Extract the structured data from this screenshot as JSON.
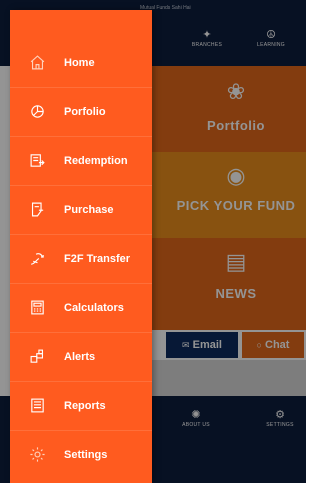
{
  "app": {
    "title": "Mutual Funds Sahi Hai",
    "top_nav": [
      {
        "label": "BRANCHES",
        "icon": "branches-icon"
      },
      {
        "label": "LEARNING",
        "icon": "learning-icon"
      }
    ],
    "tiles": {
      "portfolio": "Portfolio",
      "pick_fund": "PICK YOUR FUND",
      "news": "NEWS"
    },
    "contact": {
      "email": "Email",
      "chat": "Chat"
    },
    "bottom_nav": [
      {
        "label": "ABOUT US",
        "icon": "about-icon"
      },
      {
        "label": "SETTINGS",
        "icon": "settings-icon"
      }
    ]
  },
  "drawer": {
    "items": [
      {
        "label": "Home",
        "icon": "home-icon"
      },
      {
        "label": "Porfolio",
        "icon": "portfolio-icon"
      },
      {
        "label": "Redemption",
        "icon": "redemption-icon"
      },
      {
        "label": "Purchase",
        "icon": "purchase-icon"
      },
      {
        "label": "F2F Transfer",
        "icon": "f2f-transfer-icon"
      },
      {
        "label": "Calculators",
        "icon": "calculator-icon"
      },
      {
        "label": "Alerts",
        "icon": "alerts-icon"
      },
      {
        "label": "Reports",
        "icon": "reports-icon"
      },
      {
        "label": "Settings",
        "icon": "settings-icon"
      }
    ]
  },
  "colors": {
    "drawer_bg": "#ff5b1f",
    "navy": "#0d1e3d",
    "orange_tile": "#e2681a",
    "amber_tile": "#ea8e1c"
  }
}
